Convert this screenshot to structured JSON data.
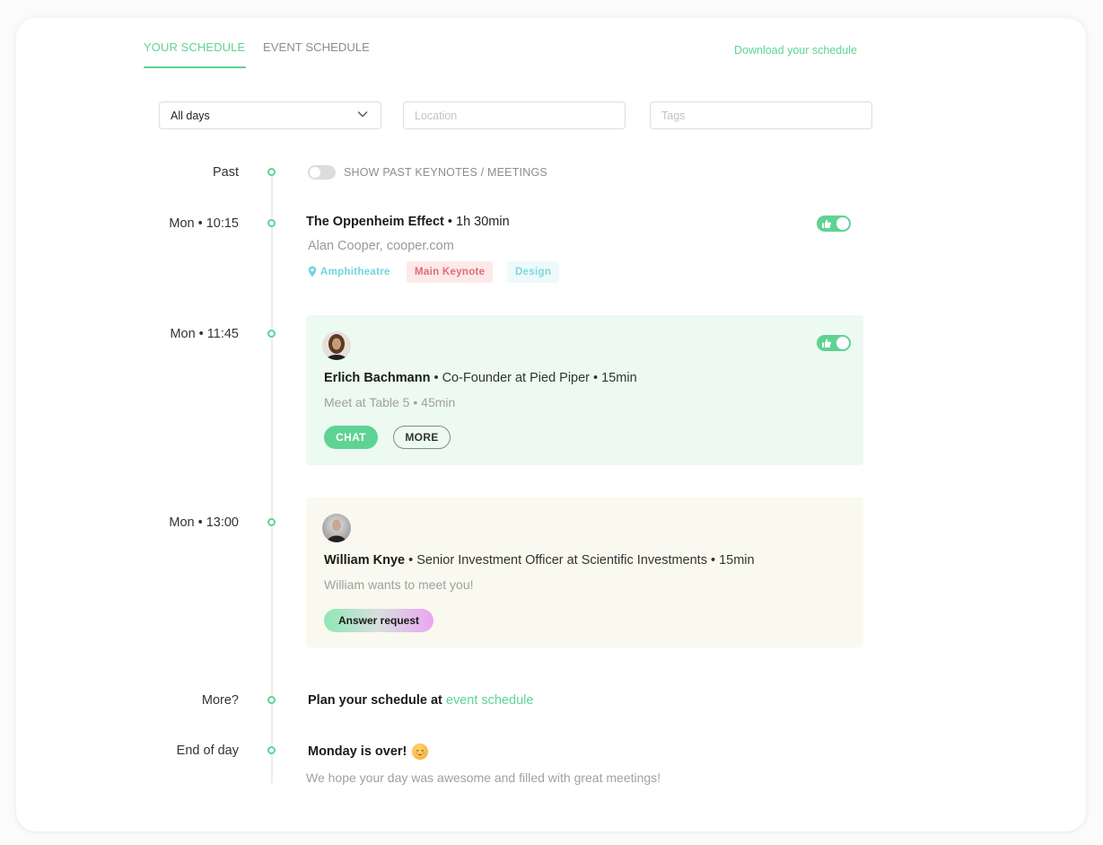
{
  "tabs": {
    "your_schedule": "YOUR SCHEDULE",
    "event_schedule": "EVENT SCHEDULE",
    "active": "your_schedule"
  },
  "download_link": "Download your schedule",
  "filters": {
    "days": {
      "value": "All days",
      "icon": "chevron-down-icon"
    },
    "location": {
      "value": "",
      "placeholder": "Location"
    },
    "tags": {
      "value": "",
      "placeholder": "Tags"
    }
  },
  "colors": {
    "accent": "#5fd393",
    "keynote_tag": "#e06d73",
    "design_tag": "#7dd8df",
    "meeting_card": "#ecfaf2",
    "request_card": "#f9f9ef"
  },
  "timeline": {
    "past": {
      "label": "Past",
      "toggle_label": "SHOW PAST KEYNOTES / MEETINGS",
      "toggle_on": false
    },
    "keynote": {
      "time": "Mon • 10:15",
      "title": "The Oppenheim Effect",
      "duration": " • 1h 30min",
      "speaker": "Alan Cooper, cooper.com",
      "location": "Amphitheatre",
      "tags": [
        "Main Keynote",
        "Design"
      ],
      "liked": true
    },
    "meeting": {
      "time": "Mon • 11:45",
      "name": "Erlich Bachmann",
      "details": " • Co-Founder at Pied Piper • 15min",
      "sub": "Meet at Table 5 • 45min",
      "chat_label": "CHAT",
      "more_label": "MORE",
      "liked": true
    },
    "request": {
      "time": "Mon • 13:00",
      "name": "William Knye",
      "details": " • Senior Investment Officer at Scientific Investments • 15min",
      "sub": "William wants to meet you!",
      "answer_label": "Answer request"
    },
    "more": {
      "label": "More?",
      "text": "Plan your schedule at ",
      "link": "event schedule"
    },
    "end_of_day": {
      "label": "End of day",
      "title": "Monday is over!",
      "emoji": "relieved-face-emoji",
      "sub": "We hope your day was awesome and filled with great meetings!"
    }
  }
}
